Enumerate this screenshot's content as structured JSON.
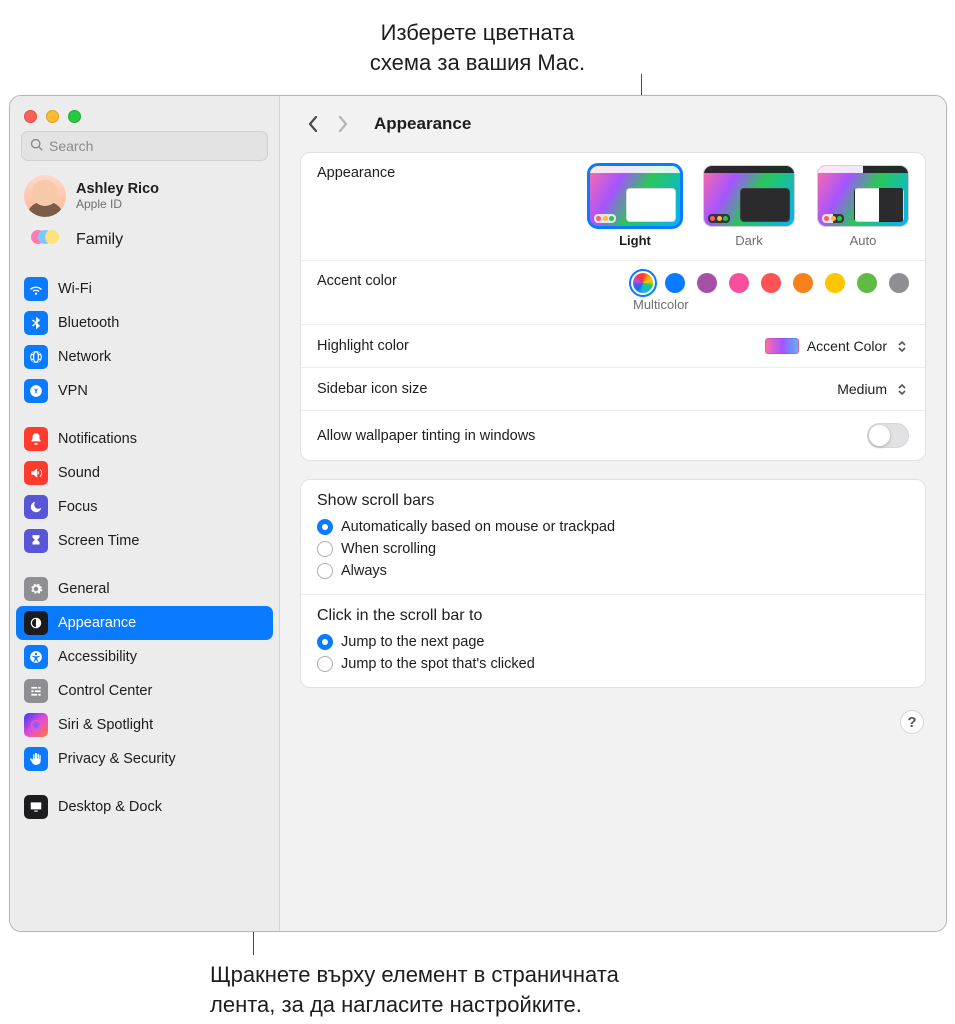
{
  "callouts": {
    "top": "Изберете цветната\nсхема за вашия Mac.",
    "bottom": "Щракнете върху елемент в страничната\nлента, за да нагласите настройките."
  },
  "search": {
    "placeholder": "Search"
  },
  "account": {
    "name": "Ashley Rico",
    "sub": "Apple ID"
  },
  "family": {
    "label": "Family"
  },
  "sidebar": {
    "group1": [
      {
        "label": "Wi-Fi",
        "color": "#0a7aff",
        "icon": "wifi"
      },
      {
        "label": "Bluetooth",
        "color": "#0a7aff",
        "icon": "bluetooth"
      },
      {
        "label": "Network",
        "color": "#0a7aff",
        "icon": "globe"
      },
      {
        "label": "VPN",
        "color": "#0a7aff",
        "icon": "vpn"
      }
    ],
    "group2": [
      {
        "label": "Notifications",
        "color": "#ff3b30",
        "icon": "bell"
      },
      {
        "label": "Sound",
        "color": "#ff3b30",
        "icon": "sound"
      },
      {
        "label": "Focus",
        "color": "#5856d6",
        "icon": "moon"
      },
      {
        "label": "Screen Time",
        "color": "#5856d6",
        "icon": "hourglass"
      }
    ],
    "group3": [
      {
        "label": "General",
        "color": "#8e8e93",
        "icon": "gear"
      },
      {
        "label": "Appearance",
        "color": "#1c1c1e",
        "icon": "appearance",
        "selected": true
      },
      {
        "label": "Accessibility",
        "color": "#0a7aff",
        "icon": "accessibility"
      },
      {
        "label": "Control Center",
        "color": "#8e8e93",
        "icon": "controlcenter"
      },
      {
        "label": "Siri & Spotlight",
        "color": "grad",
        "icon": "siri"
      },
      {
        "label": "Privacy & Security",
        "color": "#0a7aff",
        "icon": "hand"
      }
    ],
    "group4": [
      {
        "label": "Desktop & Dock",
        "color": "#1c1c1e",
        "icon": "desktop"
      }
    ]
  },
  "header": {
    "title": "Appearance"
  },
  "appearance": {
    "label": "Appearance",
    "options": [
      {
        "label": "Light",
        "selected": true,
        "theme": "light"
      },
      {
        "label": "Dark",
        "theme": "dark"
      },
      {
        "label": "Auto",
        "theme": "auto"
      }
    ]
  },
  "accent": {
    "label": "Accent color",
    "selected_name": "Multicolor",
    "colors": [
      {
        "hex": "multi",
        "selected": true
      },
      {
        "hex": "#0a7aff"
      },
      {
        "hex": "#a550a7"
      },
      {
        "hex": "#f74f9e"
      },
      {
        "hex": "#ff5257"
      },
      {
        "hex": "#f7821b"
      },
      {
        "hex": "#ffc600"
      },
      {
        "hex": "#62ba46"
      },
      {
        "hex": "#8e8e93"
      }
    ]
  },
  "highlight": {
    "label": "Highlight color",
    "value": "Accent Color"
  },
  "sidebar_size": {
    "label": "Sidebar icon size",
    "value": "Medium"
  },
  "tinting": {
    "label": "Allow wallpaper tinting in windows",
    "on": false
  },
  "scrollbars": {
    "label": "Show scroll bars",
    "options": [
      {
        "label": "Automatically based on mouse or trackpad",
        "on": true
      },
      {
        "label": "When scrolling"
      },
      {
        "label": "Always"
      }
    ]
  },
  "scrollclick": {
    "label": "Click in the scroll bar to",
    "options": [
      {
        "label": "Jump to the next page",
        "on": true
      },
      {
        "label": "Jump to the spot that's clicked"
      }
    ]
  },
  "help": {
    "char": "?"
  }
}
